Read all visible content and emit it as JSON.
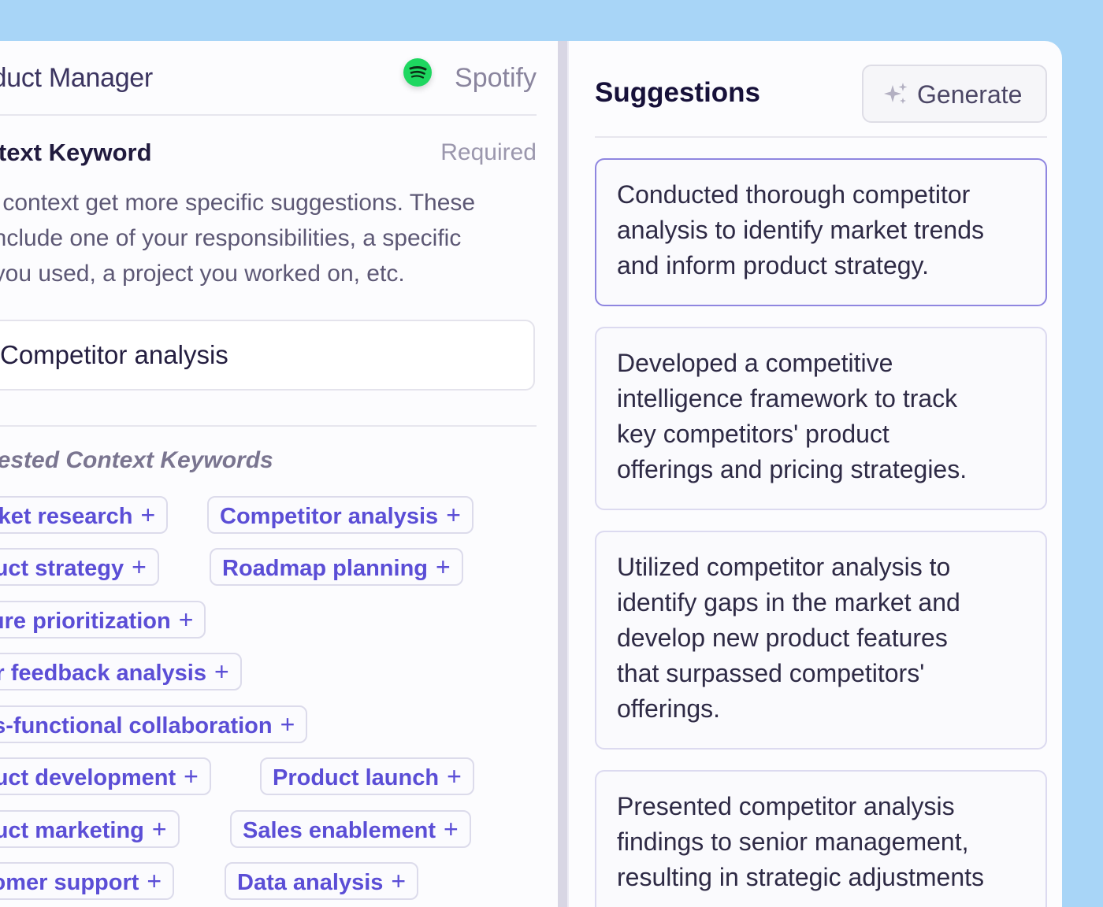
{
  "job": {
    "title": "roduct Manager",
    "company": "Spotify",
    "company_icon": "spotify-logo-icon"
  },
  "context": {
    "label": "ontext Keyword",
    "required": "Required",
    "description_lines": [
      "ter context get more specific suggestions. These",
      "n include one of your responsibilities, a specific",
      "ol you used, a project you worked on, etc."
    ],
    "input_value": "Competitor analysis"
  },
  "suggested_keywords": {
    "title": "ggested Context Keywords",
    "rows": [
      [
        "Market research",
        "Competitor analysis"
      ],
      [
        "roduct strategy",
        "Roadmap planning"
      ],
      [
        "eature prioritization"
      ],
      [
        "Jser feedback analysis"
      ],
      [
        "ross-functional collaboration"
      ],
      [
        "roduct development",
        "Product launch"
      ],
      [
        "roduct marketing",
        "Sales enablement"
      ],
      [
        "ustomer support",
        "Data analysis"
      ]
    ],
    "add_symbol": "+"
  },
  "suggestions": {
    "title": "Suggestions",
    "generate_label": "Generate",
    "generate_icon": "sparkle-icon",
    "items": [
      [
        "Conducted thorough competitor",
        "analysis to identify market trends",
        "and inform product strategy."
      ],
      [
        "Developed a competitive",
        "intelligence framework to track",
        "key competitors' product",
        "offerings and pricing strategies."
      ],
      [
        "Utilized competitor analysis to",
        "identify gaps in the market and",
        "develop new product features",
        "that surpassed competitors'",
        "offerings."
      ],
      [
        "Presented competitor analysis",
        "findings to senior management,",
        "resulting in strategic adjustments"
      ]
    ]
  },
  "colors": {
    "background": "#a8d5f7",
    "accent": "#5b4ed6",
    "spotify_green": "#1ed760"
  }
}
